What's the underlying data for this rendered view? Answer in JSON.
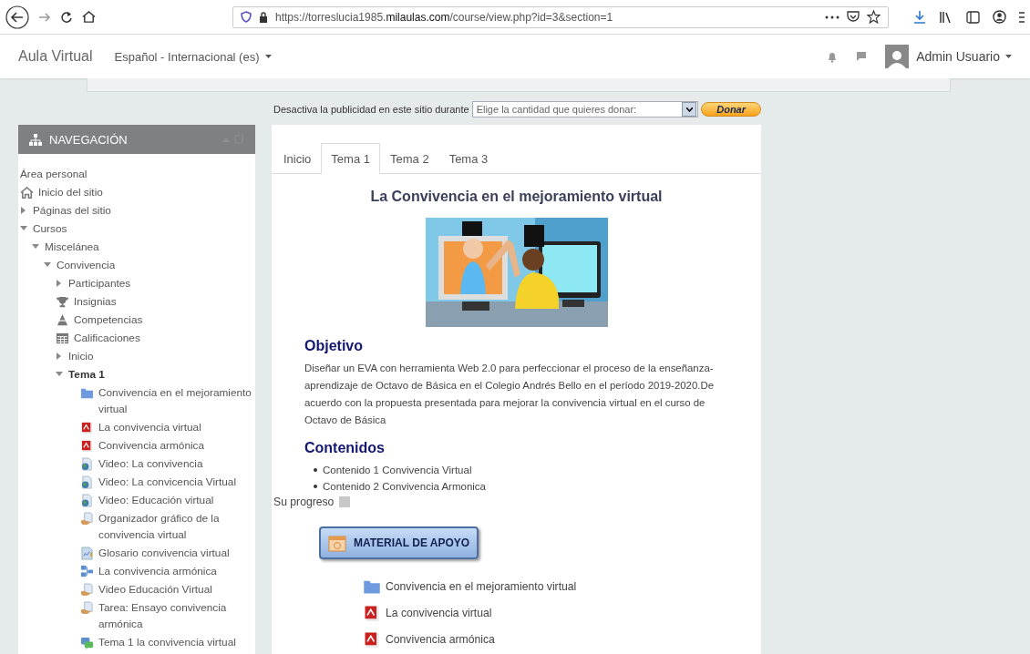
{
  "browser": {
    "url": "https://torreslucia1985.**milaulas.com**/course/view.php?id=3&section=1"
  },
  "navbar": {
    "site_name": "Aula Virtual",
    "language": "Español - Internacional (es)",
    "user": "Admin Usuario"
  },
  "donate": {
    "label": "Desactiva la publicidad en este sitio durante",
    "select_value": "Elige la cantidad que quieres donar:",
    "button": "Donar"
  },
  "navigation": {
    "title": "NAVEGACIÓN",
    "tree": [
      {
        "label": "Área personal"
      },
      {
        "label": "Inicio del sitio",
        "kind": "home"
      },
      {
        "label": "Páginas del sitio",
        "expanded": false
      },
      {
        "label": "Cursos",
        "expanded": true,
        "children": [
          {
            "label": "Miscelánea",
            "expanded": true,
            "children": [
              {
                "label": "Convivencia",
                "expanded": true,
                "children": [
                  {
                    "label": "Participantes",
                    "expanded": false,
                    "current": false
                  },
                  {
                    "label": "Insignias",
                    "kind": "trophy",
                    "current": false
                  },
                  {
                    "label": "Competencias",
                    "kind": "competency",
                    "current": false
                  },
                  {
                    "label": "Calificaciones",
                    "kind": "grades",
                    "current": false
                  },
                  {
                    "label": "Inicio",
                    "expanded": false,
                    "current": false
                  },
                  {
                    "label": "Tema 1",
                    "expanded": true,
                    "current": true,
                    "children": [
                      {
                        "label": "Convivencia en el mejoramiento virtual",
                        "kind": "folder"
                      },
                      {
                        "label": "La convivencia virtual",
                        "kind": "pdf"
                      },
                      {
                        "label": "Convivencia armónica",
                        "kind": "pdf"
                      },
                      {
                        "label": "Video: La convivencia",
                        "kind": "url"
                      },
                      {
                        "label": "Video: La convicencia Virtual",
                        "kind": "url"
                      },
                      {
                        "label": "Video: Educación virtual",
                        "kind": "url"
                      },
                      {
                        "label": "Organizador gráfico de la convivencia virtual",
                        "kind": "assignment"
                      },
                      {
                        "label": "Glosario convivencia virtual",
                        "kind": "glossary"
                      },
                      {
                        "label": "La convivencia armónica",
                        "kind": "book"
                      },
                      {
                        "label": "Video Educación Virtual",
                        "kind": "assignment"
                      },
                      {
                        "label": "Tarea: Ensayo convivencia armónica",
                        "kind": "assignment"
                      },
                      {
                        "label": "Tema 1 la convivencia virtual",
                        "kind": "forum"
                      }
                    ]
                  }
                ]
              }
            ]
          }
        ]
      }
    ]
  },
  "course": {
    "tabs": [
      {
        "label": "Inicio",
        "selected": false
      },
      {
        "label": "Tema 1",
        "selected": true
      },
      {
        "label": "Tema 2",
        "selected": false
      },
      {
        "label": "Tema 3",
        "selected": false
      }
    ],
    "title": "La Convivencia en el mejoramiento virtual",
    "objective": {
      "heading": "Objetivo",
      "text": "Diseñar un EVA con herramienta Web 2.0 para perfeccionar el proceso de la enseñanza-aprendizaje de Octavo de Básica en el Colegio Andrés Bello en el período 2019-2020.De acuerdo con la propuesta presentada para mejorar la convivencia virtual en el curso de Octavo de Básica"
    },
    "contents": {
      "heading": "Contenidos",
      "items": [
        "Contenido 1 Convivencia Virtual",
        "Contenido 2 Convivencia Armonica"
      ]
    },
    "progress_label": "Su progreso",
    "material_button": "MATERIAL DE APOYO",
    "resources": [
      {
        "label": "Convivencia en el mejoramiento virtual",
        "kind": "folder"
      },
      {
        "label": "La convivencia virtual",
        "kind": "pdf"
      },
      {
        "label": "Convivencia armónica",
        "kind": "pdf"
      }
    ]
  }
}
